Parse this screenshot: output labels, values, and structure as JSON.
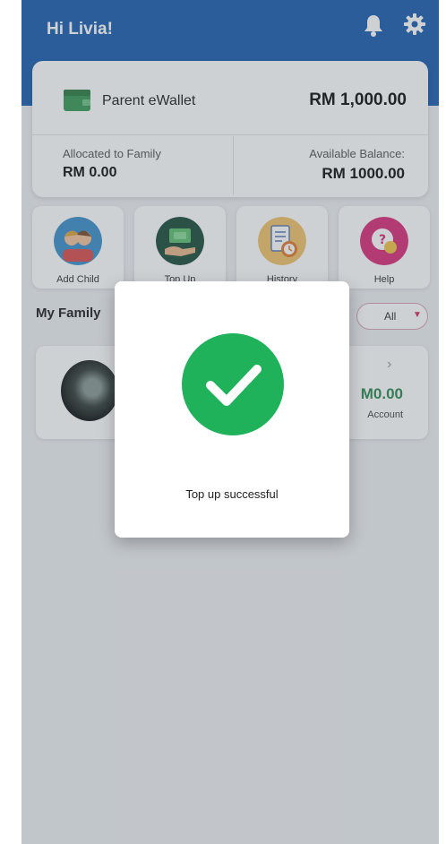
{
  "header": {
    "greeting": "Hi Livia!",
    "icons": [
      "bell-icon",
      "gear-icon"
    ],
    "background_color": "#1c5fae"
  },
  "wallet": {
    "title": "Parent eWallet",
    "amount": "RM 1,000.00",
    "allocated_label": "Allocated to Family",
    "allocated_value": "RM 0.00",
    "available_label": "Available Balance:",
    "available_value": "RM 1000.00",
    "icon": "wallet-icon"
  },
  "actions": [
    {
      "label": "Add Child",
      "icon": "add-child-icon"
    },
    {
      "label": "Top Up",
      "icon": "top-up-icon"
    },
    {
      "label": "History",
      "icon": "history-icon"
    },
    {
      "label": "Help",
      "icon": "help-icon"
    }
  ],
  "family": {
    "title": "My Family",
    "filter_value": "All",
    "child": {
      "balance": "M0.00",
      "subtitle": "Account"
    }
  },
  "modal": {
    "message": "Top up successful",
    "icon": "check-circle-icon",
    "accent_color": "#1fb25a"
  }
}
